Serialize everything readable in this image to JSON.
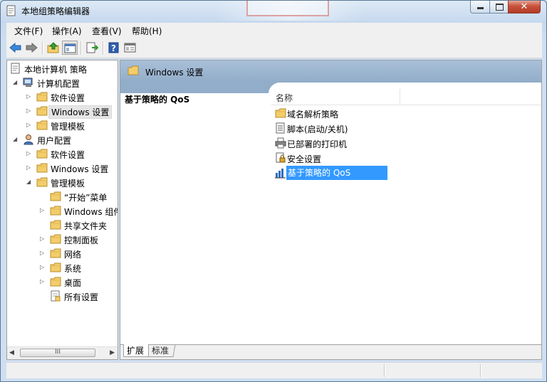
{
  "window": {
    "title": "本地组策略编辑器",
    "close_glyph": "✕"
  },
  "menu": [
    "文件(F)",
    "操作(A)",
    "查看(V)",
    "帮助(H)"
  ],
  "toolbar": [
    "back-icon",
    "forward-icon",
    "up-folder-icon",
    "show-hide-tree-icon",
    "export-list-icon",
    "help-icon",
    "properties-icon"
  ],
  "tree": [
    {
      "label": "本地计算机 策略",
      "icon": "policy-doc-icon",
      "expander": "",
      "level": 0
    },
    {
      "label": "计算机配置",
      "icon": "computer-icon",
      "expander": "open",
      "level": 1
    },
    {
      "label": "软件设置",
      "icon": "folder-icon",
      "expander": "closed",
      "level": 2
    },
    {
      "label": "Windows 设置",
      "icon": "folder-icon",
      "expander": "closed",
      "level": 2,
      "selected": true
    },
    {
      "label": "管理模板",
      "icon": "folder-icon",
      "expander": "closed",
      "level": 2
    },
    {
      "label": "用户配置",
      "icon": "user-icon",
      "expander": "open",
      "level": 1
    },
    {
      "label": "软件设置",
      "icon": "folder-icon",
      "expander": "closed",
      "level": 2
    },
    {
      "label": "Windows 设置",
      "icon": "folder-icon",
      "expander": "closed",
      "level": 2
    },
    {
      "label": "管理模板",
      "icon": "folder-icon",
      "expander": "open",
      "level": 2
    },
    {
      "label": "“开始”菜单",
      "icon": "folder-icon",
      "expander": "",
      "level": 3
    },
    {
      "label": "Windows 组件",
      "icon": "folder-icon",
      "expander": "closed",
      "level": 3
    },
    {
      "label": "共享文件夹",
      "icon": "folder-icon",
      "expander": "",
      "level": 3
    },
    {
      "label": "控制面板",
      "icon": "folder-icon",
      "expander": "closed",
      "level": 3
    },
    {
      "label": "网络",
      "icon": "folder-icon",
      "expander": "closed",
      "level": 3
    },
    {
      "label": "系统",
      "icon": "folder-icon",
      "expander": "closed",
      "level": 3
    },
    {
      "label": "桌面",
      "icon": "folder-icon",
      "expander": "closed",
      "level": 3
    },
    {
      "label": "所有设置",
      "icon": "settings-list-icon",
      "expander": "",
      "level": 3
    }
  ],
  "scrollbar": {
    "left_arrow": "◀",
    "right_arrow": "▶",
    "grip": "III"
  },
  "right_pane": {
    "header": "Windows 设置",
    "description_title": "基于策略的 QoS",
    "column_name": "名称",
    "items": [
      {
        "label": "域名解析策略",
        "icon": "folder-icon"
      },
      {
        "label": "脚本(启动/关机)",
        "icon": "script-icon"
      },
      {
        "label": "已部署的打印机",
        "icon": "printer-icon"
      },
      {
        "label": "安全设置",
        "icon": "security-icon"
      },
      {
        "label": "基于策略的 QoS",
        "icon": "qos-chart-icon",
        "selected": true
      }
    ]
  },
  "tabs": [
    "扩展",
    "标准"
  ],
  "colors": {
    "accent": "#3399ff",
    "header": "#a9c0d8",
    "folder": "#f3cd6b"
  }
}
